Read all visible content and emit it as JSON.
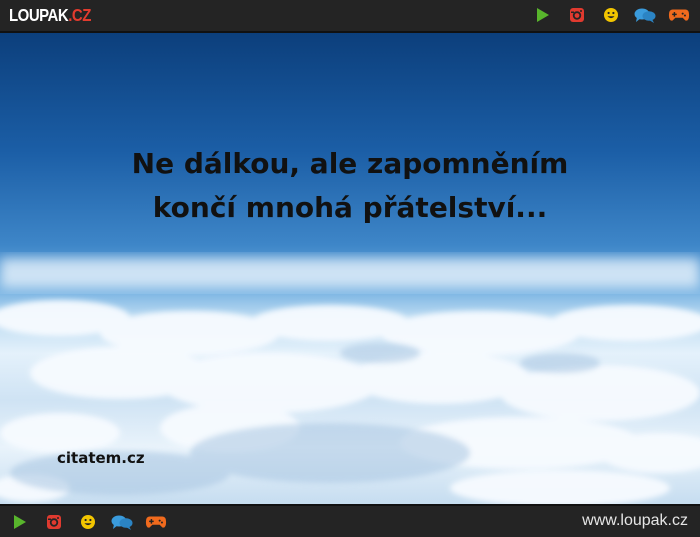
{
  "header": {
    "logo_main": "LOUPAK",
    "logo_tld": ".CZ",
    "icons": [
      "play-icon",
      "instagram-icon",
      "smiley-icon",
      "chat-icon",
      "gamepad-icon"
    ]
  },
  "image": {
    "quote_line1": "Ne dálkou, ale zapomněním",
    "quote_line2": "končí mnohá přátelství...",
    "source": "citatem.cz"
  },
  "footer": {
    "icons": [
      "play-icon",
      "instagram-icon",
      "smiley-icon",
      "chat-icon",
      "gamepad-icon"
    ],
    "url": "www.loupak.cz"
  },
  "colors": {
    "bar_bg": "#242424",
    "play": "#58b52c",
    "instagram": "#e03a2f",
    "smiley": "#f2c500",
    "chat": "#3a9bdc",
    "gamepad": "#f06a1d",
    "logo_accent": "#e23b2e"
  }
}
